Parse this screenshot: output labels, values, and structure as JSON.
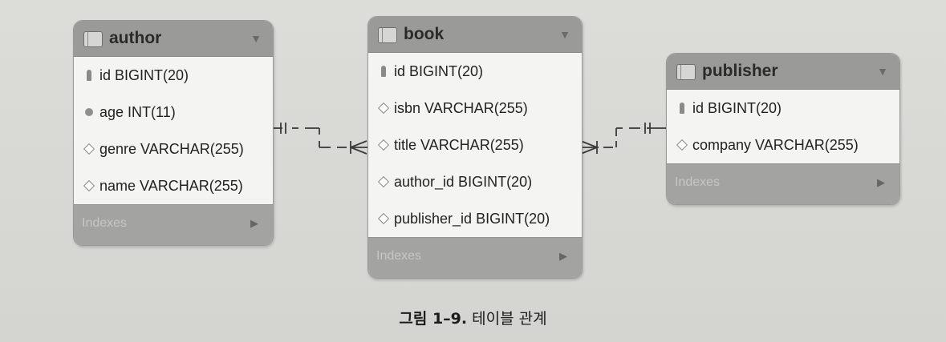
{
  "tables": {
    "author": {
      "name": "author",
      "columns": [
        {
          "text": "id BIGINT(20)",
          "icon": "key-icon"
        },
        {
          "text": "age INT(11)",
          "icon": "filled-dot-icon"
        },
        {
          "text": "genre VARCHAR(255)",
          "icon": "diamond-icon"
        },
        {
          "text": "name VARCHAR(255)",
          "icon": "diamond-icon"
        }
      ],
      "indexes": "Indexes"
    },
    "book": {
      "name": "book",
      "columns": [
        {
          "text": "id BIGINT(20)",
          "icon": "key-icon"
        },
        {
          "text": "isbn VARCHAR(255)",
          "icon": "diamond-icon"
        },
        {
          "text": "title VARCHAR(255)",
          "icon": "diamond-icon"
        },
        {
          "text": "author_id BIGINT(20)",
          "icon": "diamond-icon"
        },
        {
          "text": "publisher_id BIGINT(20)",
          "icon": "diamond-icon"
        }
      ],
      "indexes": "Indexes"
    },
    "publisher": {
      "name": "publisher",
      "columns": [
        {
          "text": "id BIGINT(20)",
          "icon": "key-icon"
        },
        {
          "text": "company VARCHAR(255)",
          "icon": "diamond-icon"
        }
      ],
      "indexes": "Indexes"
    }
  },
  "caption": {
    "number": "그림 1–9.",
    "text": "테이블 관계"
  }
}
